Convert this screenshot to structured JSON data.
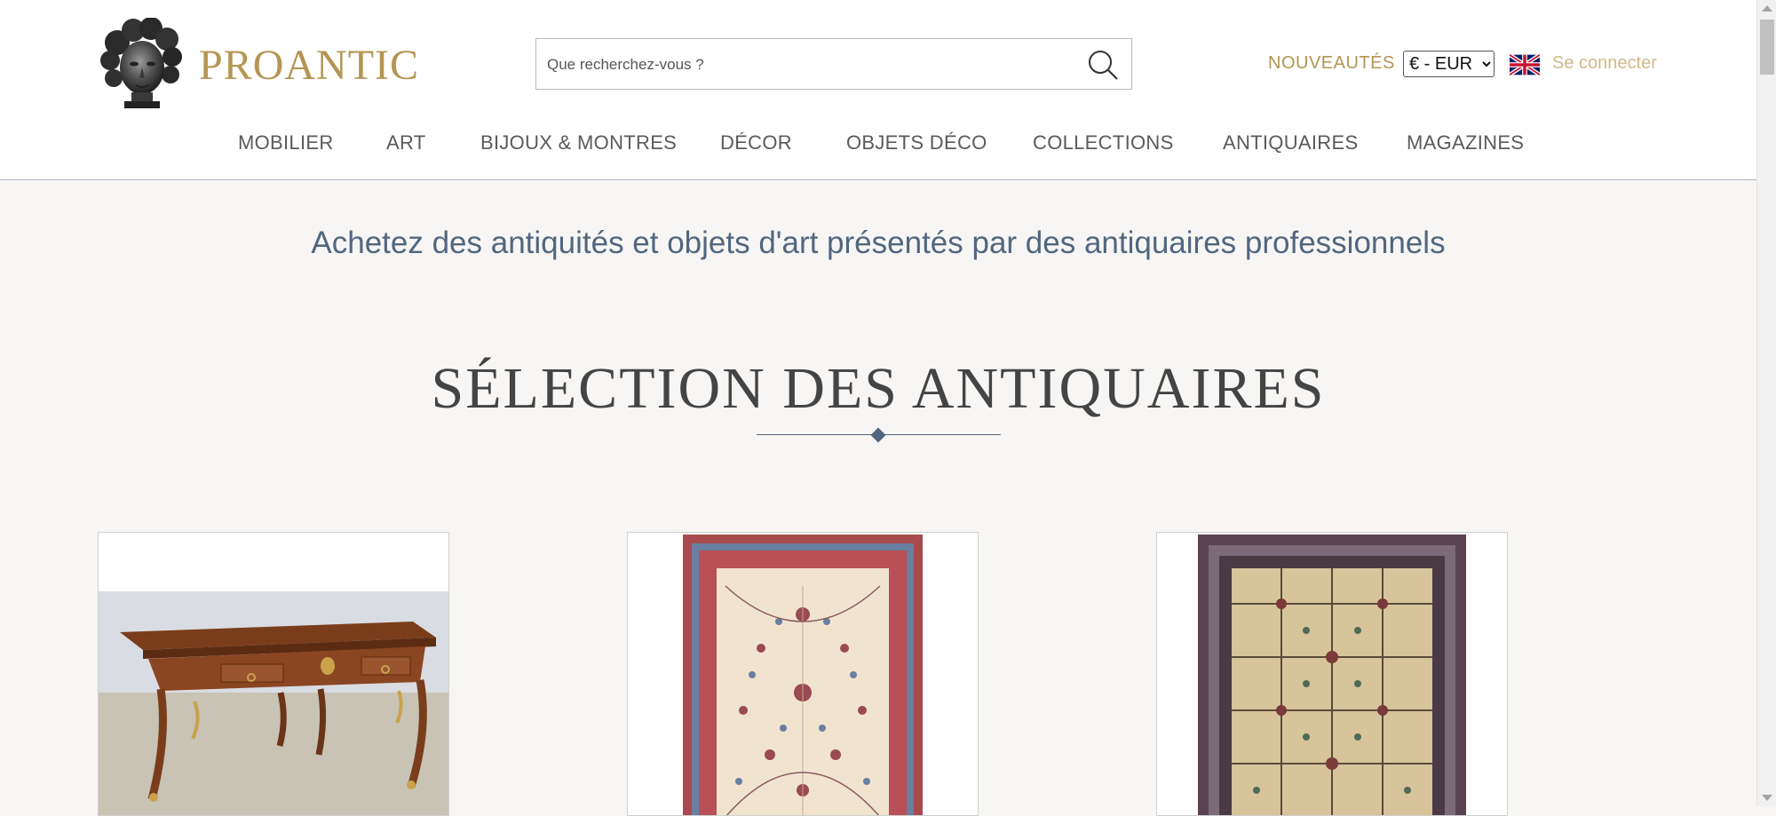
{
  "header": {
    "logo_text": "PROANTIC",
    "search": {
      "placeholder": "Que recherchez-vous ?"
    },
    "new_items_label": "NOUVEAUTÉS",
    "currency": {
      "selected": "€ - EUR"
    },
    "language_flag": "uk-flag-icon",
    "login_label": "Se connecter"
  },
  "nav": {
    "items": [
      {
        "label": "MOBILIER"
      },
      {
        "label": "ART"
      },
      {
        "label": "BIJOUX & MONTRES"
      },
      {
        "label": "DÉCOR"
      },
      {
        "label": "OBJETS DÉCO"
      },
      {
        "label": "COLLECTIONS"
      },
      {
        "label": "ANTIQUAIRES"
      },
      {
        "label": "MAGAZINES"
      }
    ]
  },
  "main": {
    "tagline": "Achetez des antiquités et objets d'art présentés par des antiquaires professionnels",
    "section_title": "SÉLECTION DES ANTIQUAIRES",
    "cards": [
      {
        "image": "writing-desk-image"
      },
      {
        "image": "persian-rug-image"
      },
      {
        "image": "antique-carpet-image"
      }
    ]
  },
  "colors": {
    "brand_gold": "#b49552",
    "accent_blue": "#52667f",
    "background": "#f7f6f4"
  }
}
